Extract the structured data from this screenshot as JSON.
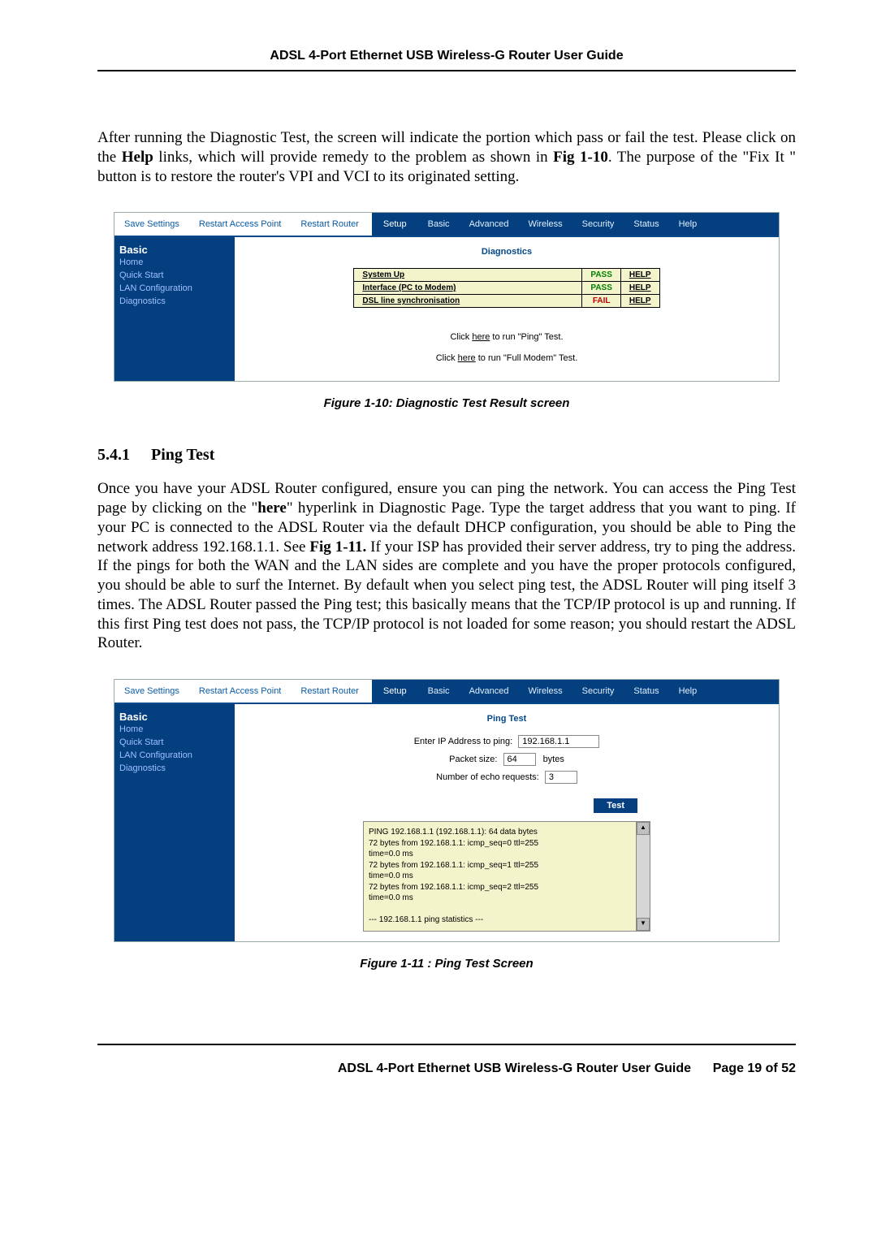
{
  "header": "ADSL 4-Port Ethernet USB Wireless-G Router User Guide",
  "footer": {
    "left": "ADSL 4-Port Ethernet USB Wireless-G Router User Guide",
    "right": "Page 19 of 52"
  },
  "intro": {
    "pre": "After running the Diagnostic Test, the screen will indicate the portion which pass or fail the test. Please click on the ",
    "help": "Help",
    "mid": " links, which will provide remedy to the problem as shown in ",
    "fig": "Fig 1-10",
    "post": ". The purpose of the \"Fix It \" button is to restore the router's VPI and VCI to its originated setting."
  },
  "nav": {
    "save": "Save Settings",
    "rap": "Restart Access Point",
    "rrouter": "Restart Router",
    "tabs": [
      "Setup",
      "Basic",
      "Advanced",
      "Wireless",
      "Security",
      "Status",
      "Help"
    ]
  },
  "side": {
    "basic": "Basic",
    "items": [
      "Home",
      "Quick Start",
      "LAN Configuration",
      "Diagnostics"
    ]
  },
  "shot1": {
    "title": "Diagnostics",
    "rows": [
      {
        "name": "System Up",
        "status": "PASS",
        "help": "HELP"
      },
      {
        "name": "Interface (PC to Modem)",
        "status": "PASS",
        "help": "HELP"
      },
      {
        "name": "DSL line synchronisation",
        "status": "FAIL",
        "help": "HELP"
      }
    ],
    "ping_line": {
      "pre": "Click ",
      "here": "here",
      "post": " to run \"Ping\" Test."
    },
    "full_line": {
      "pre": "Click ",
      "here": "here",
      "post": " to run \"Full Modem\" Test."
    },
    "caption": "Figure 1-10: Diagnostic Test Result screen"
  },
  "section": {
    "num": "5.4.1",
    "title": "Ping Test"
  },
  "para2": {
    "pre": "Once you have your ADSL Router configured, ensure you can ping the network.  You can access the Ping Test page by clicking on the \"",
    "here": "here",
    "mid": "\" hyperlink in Diagnostic Page. Type the target address that you want to ping.  If your PC is connected to the ADSL Router via the default DHCP configuration, you should be able to Ping the network address 192.168.1.1. See ",
    "fig": "Fig 1-11.",
    "post": " If your ISP has provided their server address, try to ping the address.  If the pings for both the WAN and the LAN sides are complete and you have the proper protocols configured, you should be able to surf the Internet. By default when you select ping test, the ADSL Router will ping itself 3 times. The ADSL Router passed the Ping test; this basically means that the TCP/IP protocol is up and running.  If this first Ping test does not pass, the TCP/IP protocol is not loaded for some reason; you should restart the ADSL Router."
  },
  "shot2": {
    "title": "Ping Test",
    "labels": {
      "ip": "Enter IP Address to ping:",
      "ip_val": "192.168.1.1",
      "pkt": "Packet size:",
      "pkt_val": "64",
      "pkt_unit": "bytes",
      "echo": "Number of echo requests:",
      "echo_val": "3",
      "test": "Test"
    },
    "output": "PING 192.168.1.1 (192.168.1.1): 64 data bytes\n72 bytes from 192.168.1.1: icmp_seq=0 ttl=255\ntime=0.0 ms\n72 bytes from 192.168.1.1: icmp_seq=1 ttl=255\ntime=0.0 ms\n72 bytes from 192.168.1.1: icmp_seq=2 ttl=255\ntime=0.0 ms\n\n--- 192.168.1.1 ping statistics ---",
    "caption": "Figure 1-11 : Ping Test Screen"
  }
}
